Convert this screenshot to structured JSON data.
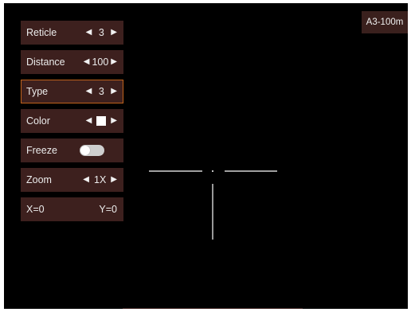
{
  "menu": {
    "reticle": {
      "label": "Reticle",
      "value": "3"
    },
    "distance": {
      "label": "Distance",
      "value": "100"
    },
    "type": {
      "label": "Type",
      "value": "3"
    },
    "color": {
      "label": "Color",
      "value": "white"
    },
    "freeze": {
      "label": "Freeze",
      "state": "on"
    },
    "zoom": {
      "label": "Zoom",
      "value": "1X"
    },
    "coords": {
      "x": "X=0",
      "y": "Y=0"
    }
  },
  "profile_badge": "A3-100m",
  "colors": {
    "screen_bg": "#000000",
    "menu_bg": "#3d201e",
    "selected_border": "#c0621b",
    "reticle": "#ffffff"
  }
}
